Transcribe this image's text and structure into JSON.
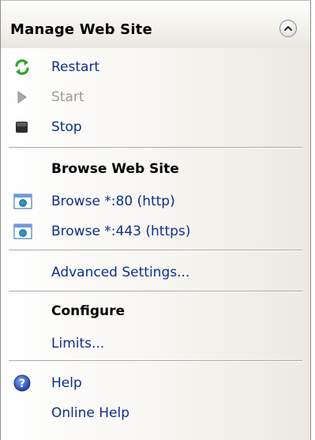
{
  "header": {
    "title": "Manage Web Site",
    "collapse_icon": "chevron-up-icon"
  },
  "manage": {
    "restart": {
      "label": "Restart",
      "icon": "restart-icon",
      "enabled": true
    },
    "start": {
      "label": "Start",
      "icon": "play-icon",
      "enabled": false
    },
    "stop": {
      "label": "Stop",
      "icon": "stop-icon",
      "enabled": true
    }
  },
  "browse": {
    "title": "Browse Web Site",
    "http": {
      "label": "Browse *:80 (http)",
      "icon": "browser-window-icon"
    },
    "https": {
      "label": "Browse *:443 (https)",
      "icon": "browser-window-icon"
    }
  },
  "advanced": {
    "label": "Advanced Settings..."
  },
  "configure": {
    "title": "Configure",
    "limits": {
      "label": "Limits..."
    }
  },
  "help": {
    "help": {
      "label": "Help",
      "icon": "help-icon"
    },
    "online_help": {
      "label": "Online Help"
    }
  },
  "colors": {
    "link": "#0f2e8a",
    "disabled": "#9a9a9a",
    "restart_green": "#2ea52e",
    "help_blue": "#1f4fc4"
  }
}
